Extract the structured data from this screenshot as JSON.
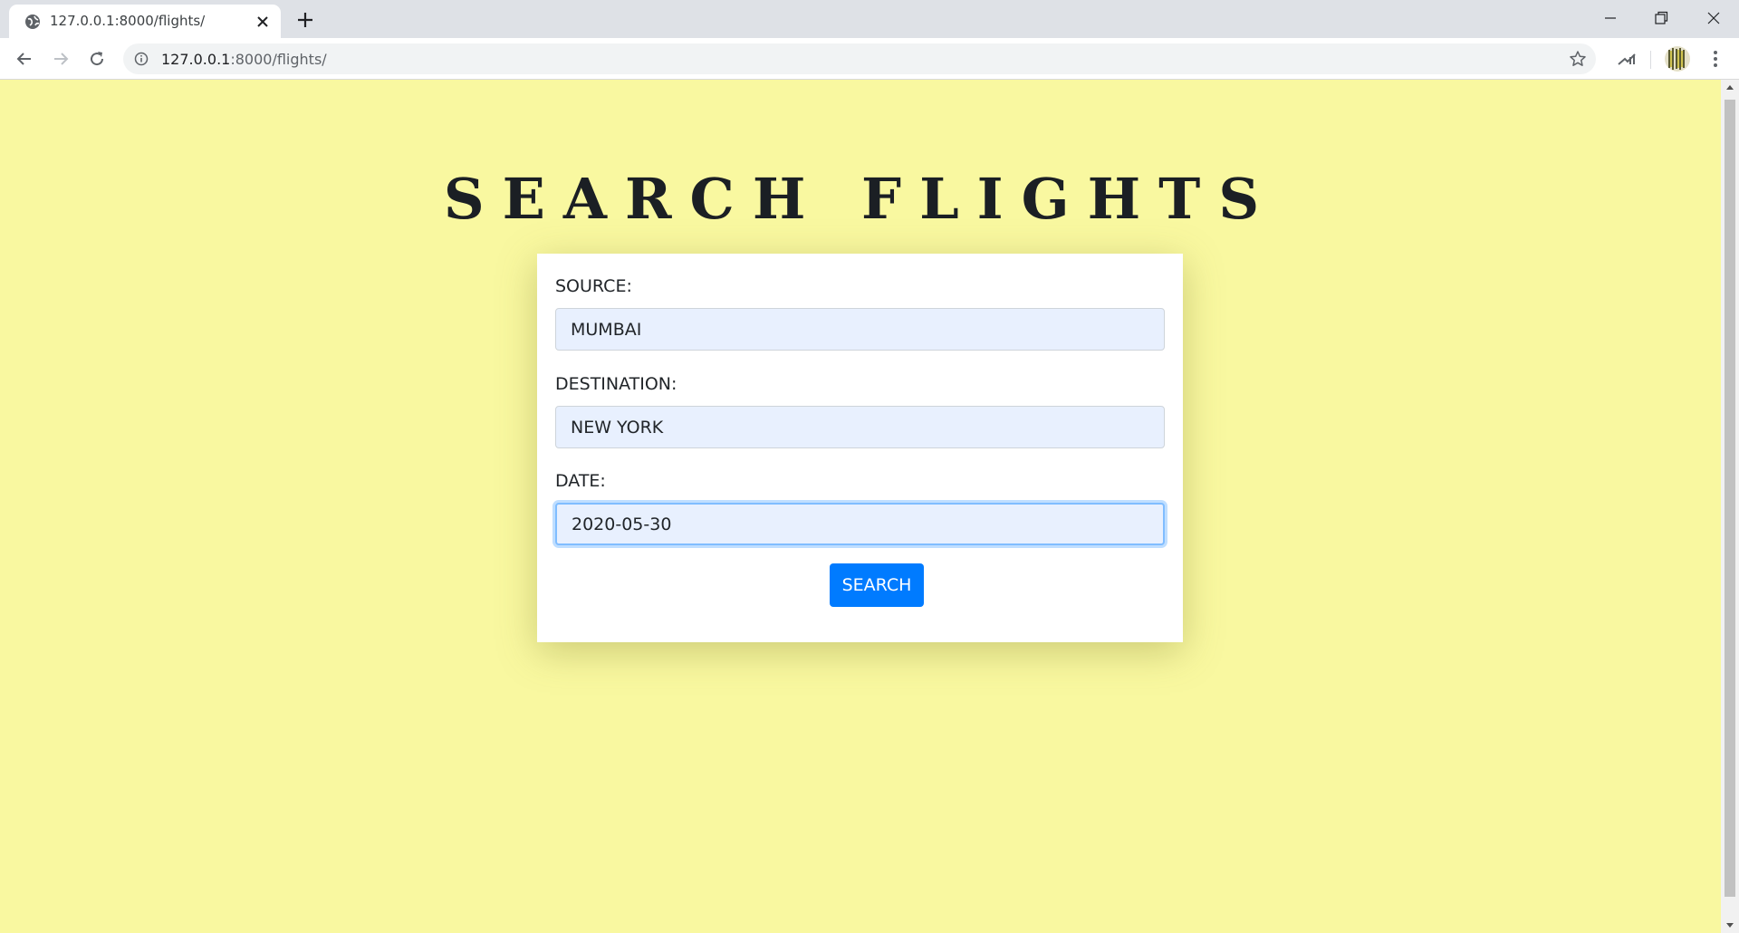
{
  "browser": {
    "tab_title": "127.0.0.1:8000/flights/",
    "url_host": "127.0.0.1",
    "url_path": ":8000/flights/"
  },
  "page": {
    "title": "SEARCH FLIGHTS",
    "background_color": "#f9f8a0"
  },
  "form": {
    "source_label": "SOURCE:",
    "source_value": "MUMBAI",
    "destination_label": "DESTINATION:",
    "destination_value": "NEW YORK",
    "date_label": "DATE:",
    "date_value": "2020-05-30",
    "submit_label": "SEARCH",
    "accent_color": "#007bff"
  },
  "icons": {
    "tab_favicon": "globe-icon",
    "tab_close": "close-icon",
    "new_tab": "plus-icon",
    "back": "arrow-left-icon",
    "forward": "arrow-right-icon",
    "reload": "reload-icon",
    "site_info": "info-icon",
    "bookmark": "star-icon",
    "menu": "kebab-menu-icon"
  }
}
